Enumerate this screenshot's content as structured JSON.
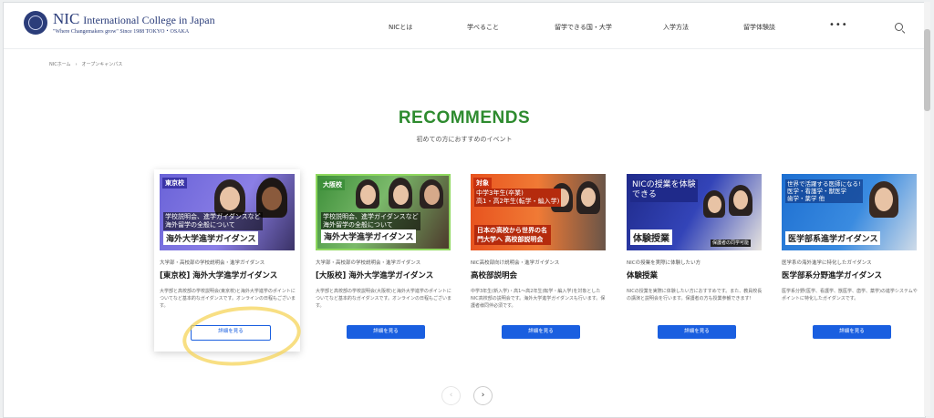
{
  "header": {
    "logo_name": "NIC",
    "logo_sub": "International College in Japan",
    "logo_tagline": "\"Where Changemakers grow\" Since 1988  TOKYO・OSAKA",
    "nav": [
      "NICとは",
      "学べること",
      "留学できる国・大学",
      "入学方法",
      "留学体験談"
    ],
    "more_label": "•••",
    "search_icon": "search-icon"
  },
  "breadcrumb": [
    "NICホーム",
    "オープンキャンパス"
  ],
  "breadcrumb_sep": "›",
  "section": {
    "title": "RECOMMENDS",
    "subtitle": "初めての方におすすめのイベント",
    "title_color": "#2e8b2f"
  },
  "cards": [
    {
      "badge": "東京校",
      "caption": "学校説明会、進学ガイダンスなど\n海外留学の全般について",
      "banner": "海外大学進学ガイダンス",
      "category": "大学部・高校部の学校説明会・進学ガイダンス",
      "title": "[東京校] 海外大学進学ガイダンス",
      "description": "大学部と高校部の学校説明会(東京校)と海外大学進学のポイントについてなど基本的なガイダンスです。オンラインの日程もございます。",
      "button": "詳細を見る"
    },
    {
      "badge": "大阪校",
      "caption": "学校説明会、進学ガイダンスなど\n海外留学の全般について",
      "banner": "海外大学進学ガイダンス",
      "category": "大学部・高校部の学校説明会・進学ガイダンス",
      "title": "[大阪校] 海外大学進学ガイダンス",
      "description": "大学部と高校部の学校説明会(大阪校)と海外大学進学のポイントについてなど基本的なガイダンスです。オンラインの日程もございます。",
      "button": "詳細を見る"
    },
    {
      "badge": "対象",
      "caption": "中学3年生(卒業)\n高1・高2年生(転学・編入学)",
      "banner": "日本の高校から世界の名門大学へ 高校部説明会",
      "category": "NIC高校部向け説明会・進学ガイダンス",
      "title": "高校部説明会",
      "description": "中学3年生(新入学)・高1～高2年生(転学・編入学)を対象としたNIC高校部の説明会です。海外大学進学ガイダンスも行います。保護者様同伴必須です。",
      "button": "詳細を見る"
    },
    {
      "badge": "",
      "caption": "NICの授業を体験できる",
      "banner": "体験授業",
      "extra": "保護者の同学可能",
      "category": "NICの授業を実際に体験したい方",
      "title": "体験授業",
      "description": "NICの授業を実際に体験したい方におすすめです。また、教員校長の講演と説明会を行います。保護者の方も授業参観できます!",
      "button": "詳細を見る"
    },
    {
      "badge": "",
      "caption": "世界で活躍する医師になる!\n医学・看護学・獣医学\n歯学・薬学 他",
      "banner": "医学部系進学ガイダンス",
      "category": "医学系の海外進学に特化したガイダンス",
      "title": "医学部系分野進学ガイダンス",
      "description": "医学系分野(医学、看護学、獣医学、歯学、薬学)の進学システムやポイントに特化したガイダンスです。",
      "button": "詳細を見る"
    }
  ],
  "pager": {
    "prev": "‹",
    "next": "›"
  },
  "colors": {
    "accent": "#1a5fe0",
    "brand": "#2b3d7a",
    "highlight": "#f5d45a"
  }
}
